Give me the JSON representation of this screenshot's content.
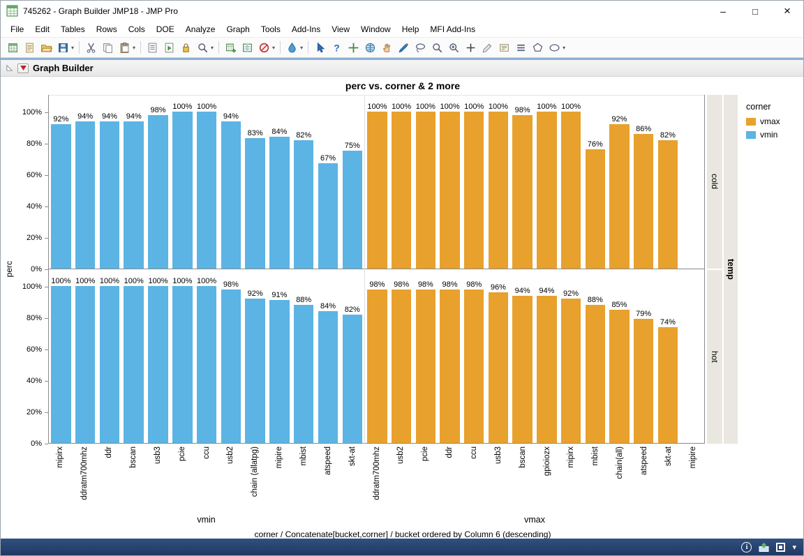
{
  "window": {
    "title": "745262 - Graph Builder JMP18 - JMP Pro",
    "controls": {
      "minimize": "–",
      "maximize": "□",
      "close": "×"
    }
  },
  "menu_bar": {
    "items": [
      "File",
      "Edit",
      "Tables",
      "Rows",
      "Cols",
      "DOE",
      "Analyze",
      "Graph",
      "Tools",
      "Add-Ins",
      "View",
      "Window",
      "Help",
      "MFI Add-Ins"
    ]
  },
  "toolbar": {
    "groups": [
      {
        "dropdown": true,
        "icons": [
          {
            "name": "new-data-table-icon",
            "kind": "newtable"
          },
          {
            "name": "new-journal-icon",
            "kind": "journal"
          },
          {
            "name": "open-file-icon",
            "kind": "open"
          },
          {
            "name": "save-icon",
            "kind": "save"
          }
        ]
      },
      {
        "dropdown": true,
        "icons": [
          {
            "name": "cut-icon",
            "kind": "cut"
          },
          {
            "name": "copy-icon",
            "kind": "copy"
          },
          {
            "name": "paste-icon",
            "kind": "paste"
          }
        ]
      },
      {
        "dropdown": true,
        "icons": [
          {
            "name": "edit-script-icon",
            "kind": "script"
          },
          {
            "name": "run-script-icon",
            "kind": "runscript"
          },
          {
            "name": "lock-icon",
            "kind": "lock"
          },
          {
            "name": "search-icon",
            "kind": "search"
          }
        ]
      },
      {
        "dropdown": true,
        "icons": [
          {
            "name": "add-rows-icon",
            "kind": "tableplus"
          },
          {
            "name": "add-columns-icon",
            "kind": "tablecols"
          },
          {
            "name": "exclude-rows-icon",
            "kind": "exclude"
          }
        ]
      },
      {
        "dropdown": true,
        "icons": [
          {
            "name": "distribution-icon",
            "kind": "droplet"
          }
        ]
      },
      {
        "dropdown": true,
        "icons": [
          {
            "name": "arrow-tool-icon",
            "kind": "arrow"
          },
          {
            "name": "help-tool-icon",
            "kind": "helptool"
          },
          {
            "name": "crosshair-tool-icon",
            "kind": "crosshair"
          },
          {
            "name": "globe-tool-icon",
            "kind": "globe"
          },
          {
            "name": "grabber-tool-icon",
            "kind": "hand"
          },
          {
            "name": "brush-tool-icon",
            "kind": "brush"
          },
          {
            "name": "lasso-tool-icon",
            "kind": "lasso"
          },
          {
            "name": "magnifier-tool-icon",
            "kind": "search"
          },
          {
            "name": "zoom-in-tool-icon",
            "kind": "magplus"
          },
          {
            "name": "plus-tool-icon",
            "kind": "plus"
          },
          {
            "name": "scalpel-tool-icon",
            "kind": "scalpel"
          },
          {
            "name": "annotate-tool-icon",
            "kind": "annotate"
          },
          {
            "name": "list-tool-icon",
            "kind": "lineslist"
          },
          {
            "name": "polygon-tool-icon",
            "kind": "polygon"
          },
          {
            "name": "oval-tool-icon",
            "kind": "oval"
          }
        ]
      }
    ]
  },
  "report": {
    "header_title": "Graph Builder"
  },
  "status_bar": {
    "icons": [
      {
        "name": "info-icon",
        "kind": "stinfo"
      },
      {
        "name": "window-manager-icon",
        "kind": "sthome"
      },
      {
        "name": "status-checkbox",
        "kind": "stcheck"
      },
      {
        "name": "status-menu-icon",
        "kind": "stdd"
      }
    ]
  },
  "chart_data": {
    "type": "bar",
    "title": "perc vs. corner & 2 more",
    "ylabel": "perc",
    "yticks": [
      "0%",
      "20%",
      "40%",
      "60%",
      "80%",
      "100%"
    ],
    "ylim": [
      0,
      100
    ],
    "grid": false,
    "legend_position": "right",
    "row_facets": [
      "cold",
      "hot"
    ],
    "row_facet_title": "temp",
    "x_axis_note": "corner / Concatenate[bucket,corner] / bucket ordered by Column 6 (descending)",
    "legend": {
      "title": "corner",
      "entries": [
        {
          "label": "vmax",
          "color": "#E8A12C"
        },
        {
          "label": "vmin",
          "color": "#5BB4E4"
        }
      ]
    },
    "col_groups": [
      {
        "label": "vmin",
        "color": "#5BB4E4",
        "categories": [
          "mipirx",
          "ddratm700mhz",
          "ddr",
          "bscan",
          "usb3",
          "pcie",
          "ccu",
          "usb2",
          "chain (allatpg)",
          "mipire",
          "mbist",
          "atspeed",
          "skt-at"
        ],
        "rows": {
          "cold": [
            92,
            94,
            94,
            94,
            98,
            100,
            100,
            94,
            83,
            84,
            82,
            67,
            75
          ],
          "hot": [
            100,
            100,
            100,
            100,
            100,
            100,
            100,
            98,
            92,
            91,
            88,
            84,
            82
          ]
        }
      },
      {
        "label": "vmax",
        "color": "#E8A12C",
        "categories": [
          "ddratm700mhz",
          "usb2",
          "pcie",
          "ddr",
          "ccu",
          "usb3",
          "bscan",
          "gpioiozx",
          "mipirx",
          "mbist",
          "chain(all)",
          "atspeed",
          "skt-at",
          "mipire"
        ],
        "rows": {
          "cold": [
            100,
            100,
            100,
            100,
            100,
            100,
            98,
            100,
            100,
            76,
            92,
            86,
            82,
            null
          ],
          "hot": [
            98,
            98,
            98,
            98,
            98,
            96,
            94,
            94,
            92,
            88,
            85,
            79,
            74,
            null
          ]
        }
      }
    ]
  }
}
